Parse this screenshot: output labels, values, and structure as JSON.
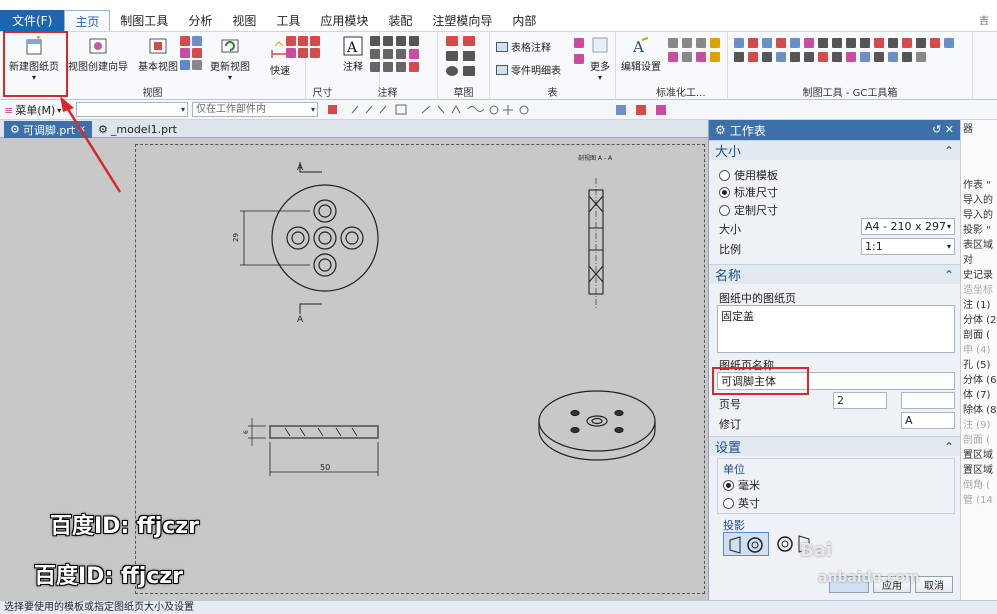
{
  "menubar": {
    "file": "文件(F)",
    "tabs": [
      "主页",
      "制图工具",
      "分析",
      "视图",
      "工具",
      "应用模块",
      "装配",
      "注塑模向导",
      "内部"
    ],
    "active_index": 0,
    "top_right_text": "吉"
  },
  "ribbon": {
    "new_sheet": "新建图纸页",
    "view_wizard": "视图创建向导",
    "base_view": "基本视图",
    "update_view": "更新视图",
    "group_view": "视图",
    "quick": "快速",
    "group_dim": "尺寸",
    "note": "注释",
    "group_note": "注释",
    "group_sketch": "草图",
    "table_note": "表格注释",
    "parts_list": "零件明细表",
    "more": "更多",
    "group_table": "表",
    "edit_settings": "编辑设置",
    "group_std": "标准化工...",
    "group_gc": "制图工具 - GC工具箱"
  },
  "toolbar": {
    "menu": "菜单(M)",
    "filter_placeholder": "仅在工作部件内"
  },
  "doctabs": {
    "tab1": "可调脚.prt",
    "tab2": "_model1.prt"
  },
  "drawing": {
    "label_a_top": "A",
    "label_a_bottom": "A",
    "section_label": "剖视图 A - A",
    "dim_vertical": "29",
    "dim_side": "6",
    "dim_width": "50"
  },
  "panel": {
    "title": "工作表",
    "size": {
      "header": "大小",
      "opt_template": "使用模板",
      "opt_standard": "标准尺寸",
      "opt_custom": "定制尺寸",
      "size_label": "大小",
      "size_value": "A4 - 210 x 297",
      "scale_label": "比例",
      "scale_value": "1:1"
    },
    "name": {
      "header": "名称",
      "list_label": "图纸中的图纸页",
      "list_item": "固定盖",
      "sheet_name_label": "图纸页名称",
      "sheet_name_value": "可调脚主体",
      "page_label": "页号",
      "page_value": "2",
      "rev_label": "修订",
      "rev_value": "A"
    },
    "settings": {
      "header": "设置",
      "unit_label": "单位",
      "unit_mm": "毫米",
      "unit_in": "英寸",
      "proj_label": "投影"
    },
    "buttons": {
      "apply": "应用",
      "cancel": "取消"
    }
  },
  "strip": {
    "top": "器",
    "items": [
      "作表 \"",
      "导入的",
      "导入的",
      "投影 \"",
      "表区域",
      "对",
      "史记录",
      "造坐标",
      "注 (1)",
      "分体 (2",
      "剖面 (",
      "申 (4)",
      "孔 (5)",
      "分体 (6",
      "体 (7)",
      "除体 (8",
      "注 (9)",
      "剖面 (",
      "置区域",
      "置区域",
      "倒角 (",
      "管 (14"
    ],
    "dim_indices": [
      7,
      11,
      16,
      17,
      20,
      21
    ]
  },
  "status": "选择要使用的模板或指定图纸页大小及设置",
  "watermark": {
    "line1": "百度ID: ffjczr",
    "line2": "百度ID: ffjczr",
    "brand": "Bai",
    "brand_sub": "anbaidu.com"
  },
  "colors": {
    "accent": "#1e64b4",
    "highlight": "#d62a2a"
  }
}
